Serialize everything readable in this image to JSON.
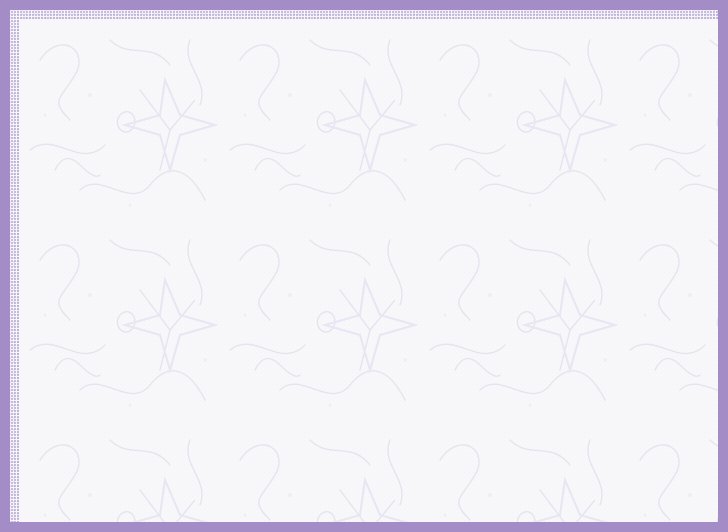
{
  "colors": {
    "border": "#a48cc6",
    "background": "#f8f8fb",
    "pattern_stroke": "#e6e6ee"
  }
}
